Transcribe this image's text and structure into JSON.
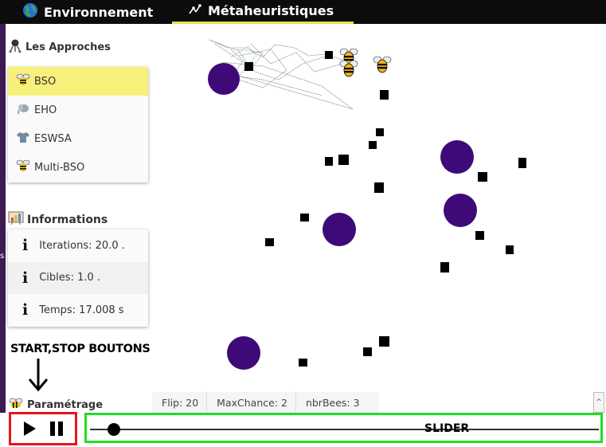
{
  "tabs": [
    {
      "label": "Environnement",
      "icon": "globe-icon"
    },
    {
      "label": "Métaheuristiques",
      "icon": "swarm-icon"
    }
  ],
  "strip_letter": "s",
  "approaches": {
    "title": "Les Approches",
    "items": [
      {
        "label": "BSO",
        "icon": "bee-icon",
        "selected": true
      },
      {
        "label": "EHO",
        "icon": "elephant-icon",
        "selected": false
      },
      {
        "label": "ESWSA",
        "icon": "tshirt-icon",
        "selected": false
      },
      {
        "label": "Multi-BSO",
        "icon": "bee-icon",
        "selected": false
      }
    ]
  },
  "informations": {
    "title": "Informations",
    "rows": [
      {
        "label": "Iterations:",
        "value": "20.0 ."
      },
      {
        "label": "Cibles:",
        "value": "1.0 ."
      },
      {
        "label": "Temps:",
        "value": "17.008 s"
      }
    ]
  },
  "annotation": "START,STOP BOUTONS",
  "settings_title": "Paramétrage",
  "status": [
    "Flip: 20",
    "MaxChance: 2",
    "nbrBees: 3"
  ],
  "controls": {
    "play": "play-icon",
    "pause": "pause-icon"
  },
  "slider": {
    "label": "SLIDER",
    "value_fraction": 0.03
  },
  "colors": {
    "accent_tab": "#e6e04a",
    "selected_item": "#f7f07a",
    "target": "#3e0a78",
    "start_stop_box": "#e8151b",
    "slider_box": "#22dd22"
  }
}
